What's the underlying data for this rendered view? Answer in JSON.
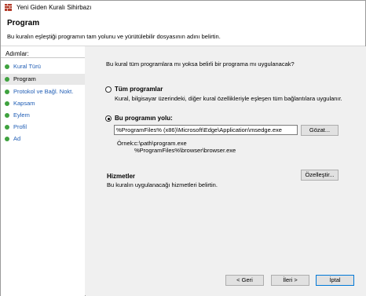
{
  "window": {
    "title": "Yeni Giden Kuralı Sihirbazı"
  },
  "header": {
    "title": "Program",
    "subtitle": "Bu kuralın eşleştiği programın tam yolunu ve yürütülebilir dosyasının adını belirtin."
  },
  "sidebar": {
    "heading": "Adımlar:",
    "steps": [
      {
        "label": "Kural Türü"
      },
      {
        "label": "Program"
      },
      {
        "label": "Protokol ve Bağl. Nokt."
      },
      {
        "label": "Kapsam"
      },
      {
        "label": "Eylem"
      },
      {
        "label": "Profil"
      },
      {
        "label": "Ad"
      }
    ]
  },
  "main": {
    "question": "Bu kural tüm programlara mı yoksa belirli bir programa mı uygulanacak?",
    "option_all_label": "Tüm programlar",
    "option_all_desc": "Kural, bilgisayar üzerindeki, diğer kural özellikleriyle eşleşen tüm bağlantılara uygulanır.",
    "option_path_label": "Bu programın yolu:",
    "path_value": "%ProgramFiles% (x86)\\Microsoft\\Edge\\Application\\msedge.exe",
    "browse_label": "Gözat...",
    "example_label": "Örnek:",
    "example_line1": "c:\\path\\program.exe",
    "example_line2": "%ProgramFiles%\\browser\\browser.exe",
    "services_title": "Hizmetler",
    "services_desc": "Bu kuralın uygulanacağı hizmetleri belirtin.",
    "customize_label": "Özelleştir..."
  },
  "footer": {
    "back_label": "< Geri",
    "next_label": "İleri >",
    "cancel_label": "İptal"
  },
  "colors": {
    "step_link": "#1f5db5",
    "step_dot": "#3fa23f",
    "active_step_bg": "#e8e8e8"
  }
}
